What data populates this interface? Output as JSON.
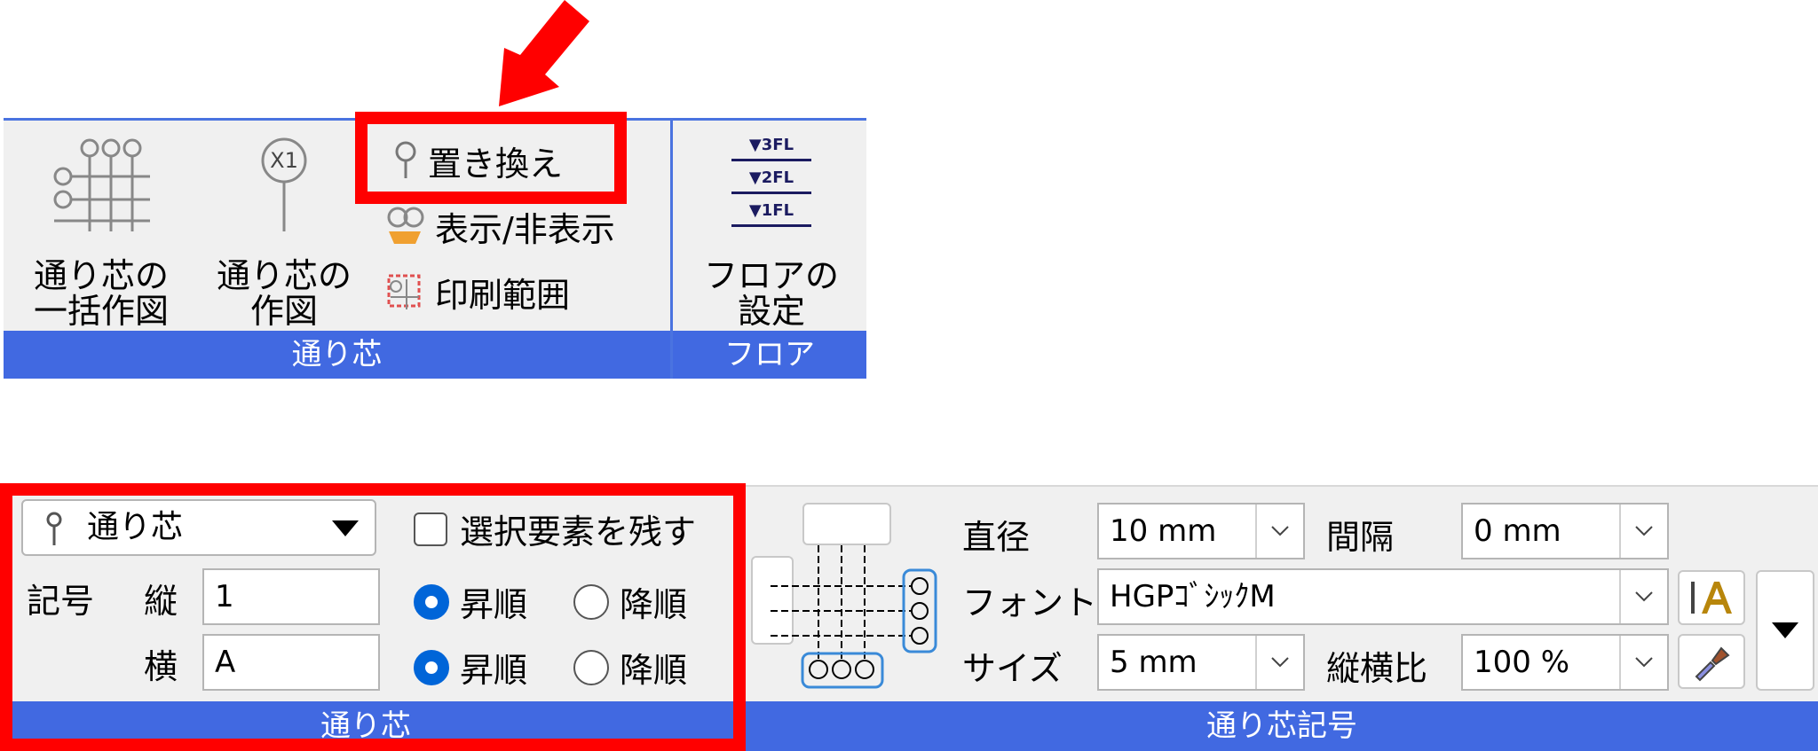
{
  "annotation": {
    "arrow_color": "#ff0000",
    "highlight_color": "#ff0000"
  },
  "top_ribbon": {
    "group_grid": {
      "caption": "通り芯",
      "batch_draw_label": "通り芯の\n一括作図",
      "draw_label": "通り芯の\n作図",
      "draw_badge": "X1",
      "replace_label": "置き換え",
      "show_hide_label": "表示/非表示",
      "print_range_label": "印刷範囲"
    },
    "group_floor": {
      "caption": "フロア",
      "floor_settings_label": "フロアの\n設定",
      "floor_lines": [
        "▼3FL",
        "▼2FL",
        "▼1FL"
      ]
    }
  },
  "bottom_ribbon": {
    "group_grid": {
      "caption": "通り芯",
      "type_select": "通り芯",
      "keep_selected_label": "選択要素を残す",
      "symbol_label": "記号",
      "vertical_label": "縦",
      "vertical_value": "1",
      "horizontal_label": "横",
      "horizontal_value": "A",
      "ascending_label": "昇順",
      "descending_label": "降順"
    },
    "group_symbol": {
      "caption": "通り芯記号",
      "diameter_label": "直径",
      "diameter_value": "10 mm",
      "spacing_label": "間隔",
      "spacing_value": "0 mm",
      "font_label": "フォント",
      "font_value": "HGPｺﾞｼｯｸM",
      "size_label": "サイズ",
      "size_value": "5 mm",
      "aspect_label": "縦横比",
      "aspect_value": "100 %"
    }
  }
}
